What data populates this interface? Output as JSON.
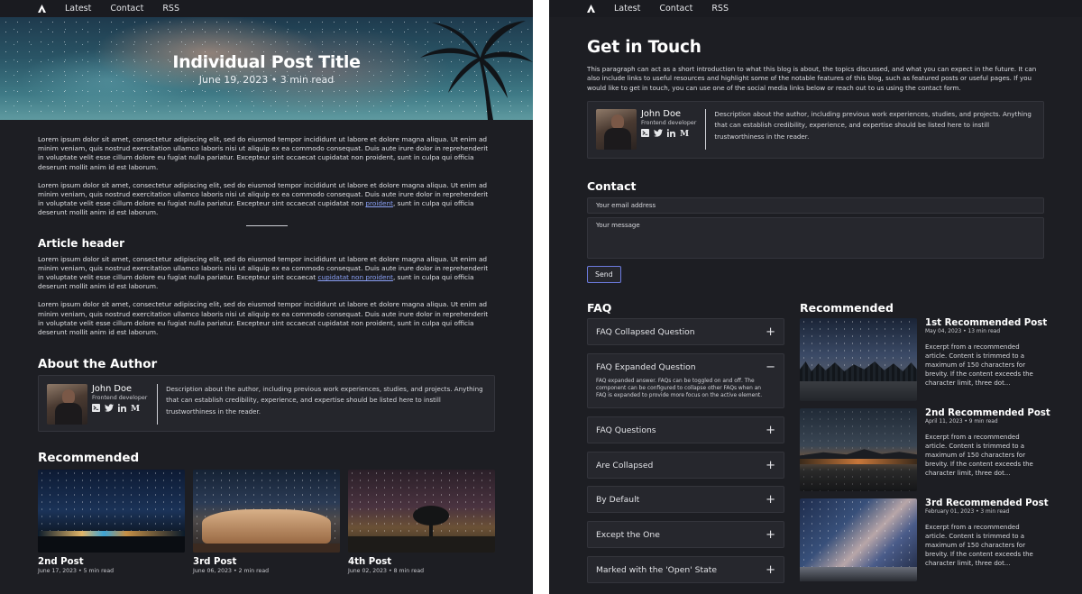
{
  "nav": {
    "items": [
      "Latest",
      "Contact",
      "RSS"
    ]
  },
  "post": {
    "title": "Individual Post Title",
    "meta": "June 19, 2023 • 3 min read",
    "paragraphs": [
      "Lorem ipsum dolor sit amet, consectetur adipiscing elit, sed do eiusmod tempor incididunt ut labore et dolore magna aliqua. Ut enim ad minim veniam, quis nostrud exercitation ullamco laboris nisi ut aliquip ex ea commodo consequat. Duis aute irure dolor in reprehenderit in voluptate velit esse cillum dolore eu fugiat nulla pariatur. Excepteur sint occaecat cupidatat non proident, sunt in culpa qui officia deserunt mollit anim id est laborum.",
      "Lorem ipsum dolor sit amet, consectetur adipiscing elit, sed do eiusmod tempor incididunt ut labore et dolore magna aliqua. Ut enim ad minim veniam, quis nostrud exercitation ullamco laboris nisi ut aliquip ex ea commodo consequat. Duis aute irure dolor in reprehenderit in voluptate velit esse cillum dolore eu fugiat nulla pariatur. Excepteur sint occaecat cupidatat non"
    ],
    "p2_link": "proident",
    "p2_tail": ", sunt in culpa qui officia deserunt mollit anim id est laborum.",
    "article_header": "Article header",
    "p3_head": "Lorem ipsum dolor sit amet, consectetur adipiscing elit, sed do eiusmod tempor incididunt ut labore et dolore magna aliqua. Ut enim ad minim veniam, quis nostrud exercitation ullamco laboris nisi ut aliquip ex ea commodo consequat. Duis aute irure dolor in reprehenderit in voluptate velit esse cillum dolore eu fugiat nulla pariatur. Excepteur sint occaecat",
    "p3_link": "cupidatat non proident",
    "p3_tail": ", sunt in culpa qui officia deserunt mollit anim id est laborum.",
    "p4": "Lorem ipsum dolor sit amet, consectetur adipiscing elit, sed do eiusmod tempor incididunt ut labore et dolore magna aliqua. Ut enim ad minim veniam, quis nostrud exercitation ullamco laboris nisi ut aliquip ex ea commodo consequat. Duis aute irure dolor in reprehenderit in voluptate velit esse cillum dolore eu fugiat nulla pariatur. Excepteur sint occaecat cupidatat non proident, sunt in culpa qui officia deserunt mollit anim id est laborum."
  },
  "about": {
    "heading": "About the Author",
    "name": "John Doe",
    "role": "Frontend developer",
    "description": "Description about the author, including previous work experiences, studies, and projects. Anything that can establish credibility, experience, and expertise should be listed here to instill trustworthiness in the reader."
  },
  "recommended_left": {
    "heading": "Recommended",
    "posts": [
      {
        "title": "2nd Post",
        "meta": "June 17, 2023 • 5 min read"
      },
      {
        "title": "3rd Post",
        "meta": "June 06, 2023 • 2 min read"
      },
      {
        "title": "4th Post",
        "meta": "June 02, 2023 • 8 min read"
      }
    ]
  },
  "contact_page": {
    "title": "Get in Touch",
    "intro": "This paragraph can act as a short introduction to what this blog is about, the topics discussed, and what you can expect in the future. It can also include links to useful resources and highlight some of the notable features of this blog, such as featured posts or useful pages. If you would like to get in touch, you can use one of the social media links below or reach out to us using the contact form.",
    "contact_heading": "Contact",
    "email_placeholder": "Your email address",
    "message_placeholder": "Your message",
    "send_label": "Send"
  },
  "faq": {
    "heading": "FAQ",
    "items": [
      {
        "question": "FAQ Collapsed Question",
        "toggle": "+"
      },
      {
        "question": "FAQ Expanded Question",
        "toggle": "−",
        "answer": "FAQ expanded answer. FAQs can be toggled on and off. The component can be configured to collapse other FAQs when an FAQ is expanded to provide more focus on the active element."
      },
      {
        "question": "FAQ Questions",
        "toggle": "+"
      },
      {
        "question": "Are Collapsed",
        "toggle": "+"
      },
      {
        "question": "By Default",
        "toggle": "+"
      },
      {
        "question": "Except the One",
        "toggle": "+"
      },
      {
        "question": "Marked with the 'Open' State",
        "toggle": "+"
      }
    ]
  },
  "recommended_right": {
    "heading": "Recommended",
    "posts": [
      {
        "title": "1st Recommended Post",
        "meta": "May 04, 2023 • 13 min read",
        "excerpt": "Excerpt from a recommended article. Content is trimmed to a maximum of 150 characters for brevity. If the content exceeds the character limit, three dot..."
      },
      {
        "title": "2nd Recommended Post",
        "meta": "April 11, 2023 • 9 min read",
        "excerpt": "Excerpt from a recommended article. Content is trimmed to a maximum of 150 characters for brevity. If the content exceeds the character limit, three dot..."
      },
      {
        "title": "3rd Recommended Post",
        "meta": "February 01, 2023 • 3 min read",
        "excerpt": "Excerpt from a recommended article. Content is trimmed to a maximum of 150 characters for brevity. If the content exceeds the character limit, three dot..."
      }
    ]
  },
  "colors": {
    "background": "#1d1e23",
    "card": "#26272d",
    "accent": "#6c7be0",
    "link": "#8aa0f5"
  },
  "icons": [
    "logo-icon",
    "terminal-icon",
    "twitter-icon",
    "linkedin-icon",
    "medium-icon",
    "plus-icon",
    "minus-icon"
  ]
}
